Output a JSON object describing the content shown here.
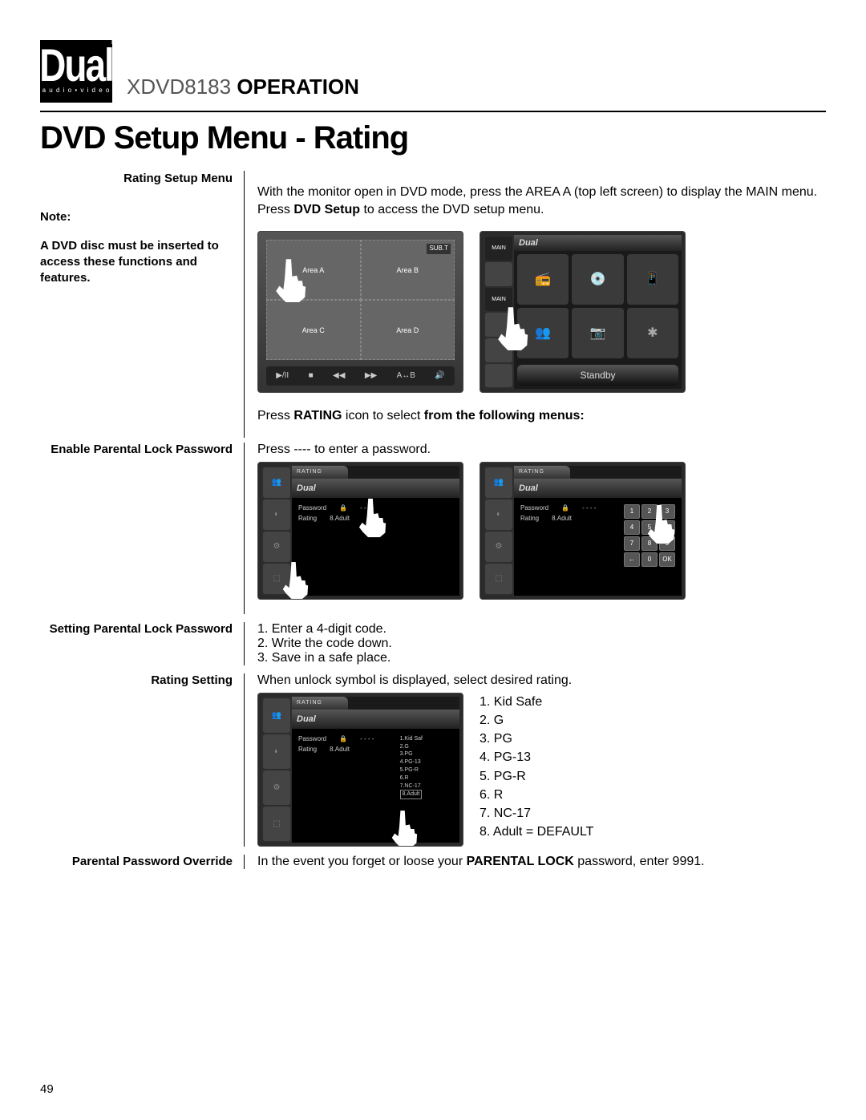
{
  "logo": {
    "brand": "Dual",
    "sub": "a u d i o • v i d e o",
    "reg": "®"
  },
  "header": {
    "model": "XDVD8183",
    "section": "OPERATION"
  },
  "page_title": "DVD Setup Menu - Rating",
  "labels": {
    "rating_setup_menu": "Rating Setup Menu",
    "note_head": "Note:",
    "note_body": "A DVD disc must be inserted to access these functions and features.",
    "enable_parental": "Enable Parental Lock Password",
    "setting_parental": "Setting Parental Lock Password",
    "rating_setting": "Rating Setting",
    "override": "Parental Password Override"
  },
  "text": {
    "intro_1": "With the monitor open in DVD mode, press the AREA A (top left screen) to display the MAIN menu. Press ",
    "intro_bold": "DVD Setup",
    "intro_2": " to access the DVD setup menu.",
    "press_rating_1": "Press ",
    "press_rating_bold1": "RATING",
    "press_rating_2": " icon to select ",
    "press_rating_bold2": "from the following menus:",
    "enable_text": "Press ---- to enter a password.",
    "setting_steps": "1. Enter a 4-digit code.\n2. Write the code down.\n3. Save in a safe place.",
    "rating_text": "When unlock symbol is displayed, select desired rating.",
    "override_1": "In the event you forget or loose your ",
    "override_bold": "PARENTAL LOCK",
    "override_2": " password, enter 9991."
  },
  "rating_list": [
    "1. Kid Safe",
    "2. G",
    "3. PG",
    "4. PG-13",
    "5. PG-R",
    "6. R",
    "7. NC-17",
    "8. Adult = DEFAULT"
  ],
  "shot1": {
    "areas": [
      "Area A",
      "Area B",
      "Area C",
      "Area D"
    ],
    "subt": "SUB.T",
    "controls": [
      "▶/II",
      "■",
      "◀◀",
      "▶▶",
      "A↔B",
      "🔊"
    ]
  },
  "shot2": {
    "side_label_top": "MAIN",
    "side_label": "MAIN",
    "standby": "Standby",
    "icons": [
      "📻",
      "💿",
      "📱",
      "👥",
      "📷",
      "✱"
    ]
  },
  "rating_shot": {
    "tab": "RATING",
    "password": "Password",
    "rating": "Rating",
    "dashes": "- - - -",
    "default_val": "8.Adult",
    "keypad": [
      "1",
      "2",
      "3",
      "4",
      "5",
      "6",
      "7",
      "8",
      "9",
      "←",
      "0",
      "OK"
    ],
    "inner_list": [
      "1.Kid Saf",
      "2.G",
      "3.PG",
      "4.PG-13",
      "5.PG-R",
      "6.R",
      "7.NC-17",
      "8.Adult"
    ]
  },
  "page_number": "49"
}
